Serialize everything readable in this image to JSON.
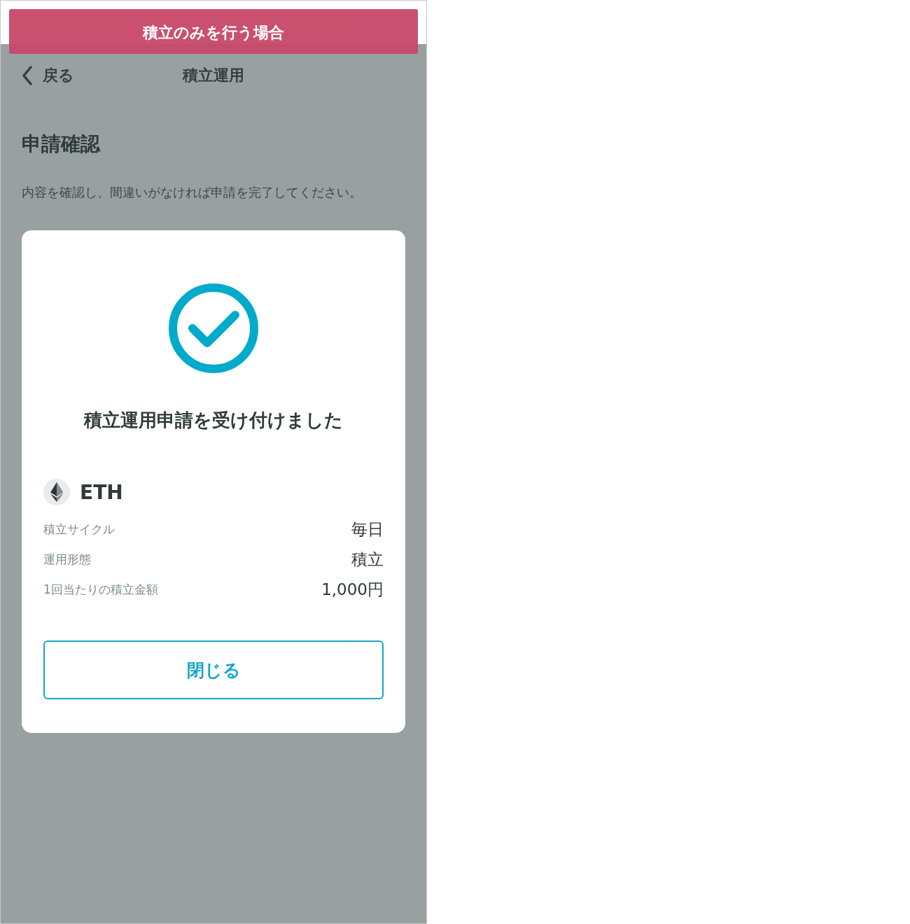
{
  "banner": {
    "title": "積立のみを行う場合"
  },
  "nav": {
    "back": "戻る",
    "title": "積立運用"
  },
  "heading": "申請確認",
  "description": "内容を確認し、間違いがなければ申請を完了してください。",
  "dialog": {
    "message": "積立運用申請を受け付けました",
    "coin": "ETH",
    "rows": [
      {
        "label": "積立サイクル",
        "value": "毎日"
      },
      {
        "label": "運用形態",
        "value": "積立"
      },
      {
        "label": "1回当たりの積立金額",
        "value": "1,000円"
      }
    ],
    "close_button": "閉じる"
  }
}
